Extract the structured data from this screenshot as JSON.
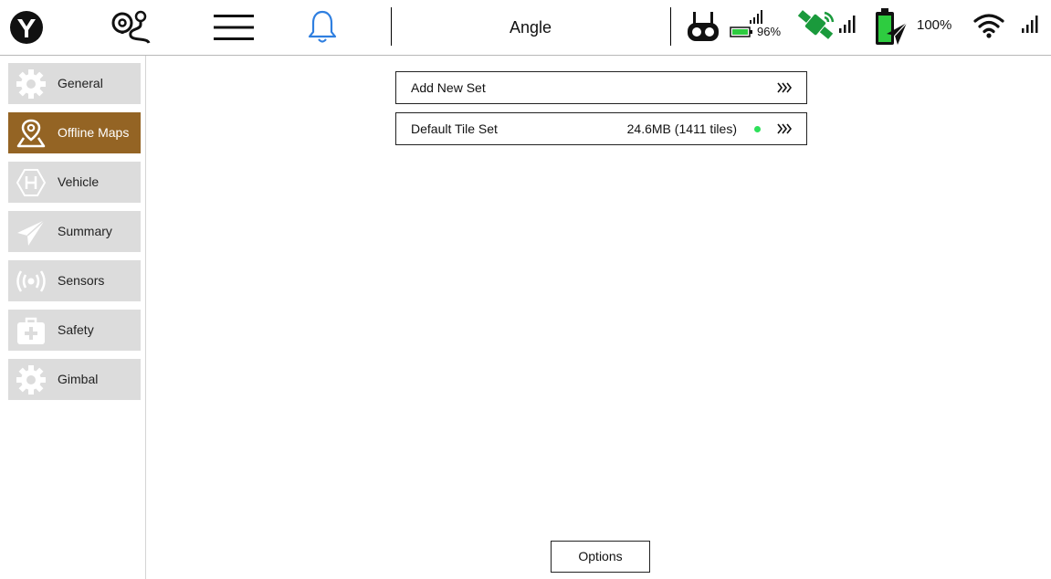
{
  "toolbar": {
    "icons": [
      "app-logo-icon",
      "route-pin-icon",
      "hamburger-menu-icon",
      "notification-bell-icon"
    ],
    "flight_mode": "Angle",
    "rc": {
      "battery_percent": "96%"
    },
    "gps": {
      "icon": "gps-satellite-icon"
    },
    "vehicle_battery": {
      "percent": "100%"
    },
    "wifi": {
      "icon": "wifi-icon"
    }
  },
  "sidebar": {
    "items": [
      {
        "label": "General",
        "icon": "gear-icon",
        "active": false
      },
      {
        "label": "Offline Maps",
        "icon": "map-pin-icon",
        "active": true
      },
      {
        "label": "Vehicle",
        "icon": "helipad-icon",
        "active": false
      },
      {
        "label": "Summary",
        "icon": "paper-plane-icon",
        "active": false
      },
      {
        "label": "Sensors",
        "icon": "signal-waves-icon",
        "active": false
      },
      {
        "label": "Safety",
        "icon": "first-aid-kit-icon",
        "active": false
      },
      {
        "label": "Gimbal",
        "icon": "gear-icon",
        "active": false
      }
    ]
  },
  "main": {
    "add_set": {
      "label": "Add New Set"
    },
    "tile_sets": [
      {
        "name": "Default Tile Set",
        "info": "24.6MB (1411 tiles)",
        "status_color": "#2ee05a"
      }
    ],
    "options_label": "Options"
  },
  "colors": {
    "accent_active": "#946424",
    "sidebar_button": "#dcdcdc",
    "bell_blue": "#2f7fe0",
    "gps_green": "#1a9a3c",
    "battery_green": "#2ecc40"
  }
}
